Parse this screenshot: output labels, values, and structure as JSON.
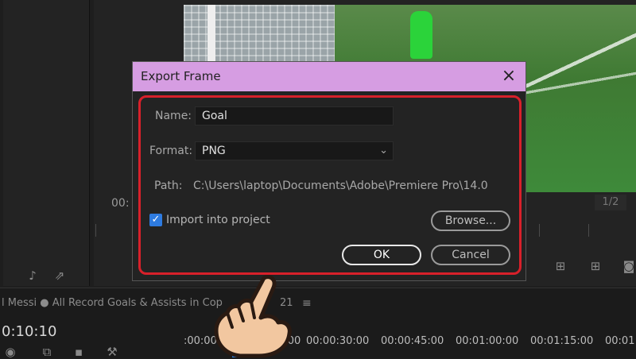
{
  "dialog": {
    "title": "Export Frame",
    "close_icon": "×",
    "name_label": "Name:",
    "name_value": "Goal",
    "format_label": "Format:",
    "format_value": "PNG",
    "format_chevron": "⌄",
    "path_label": "Path:",
    "path_value": "C:\\Users\\laptop\\Documents\\Adobe\\Premiere Pro\\14.0",
    "import_checkbox_mark": "✓",
    "import_label": "Import into project",
    "browse_label": "Browse...",
    "ok_label": "OK",
    "cancel_label": "Cancel",
    "highlight_color": "#d8202a",
    "titlebar_color": "#d69de2"
  },
  "monitor": {
    "partial_timecode": "00:",
    "page_indicator": "1/2"
  },
  "timeline": {
    "sequence_tab": "l Messi ● All Record Goals & Assists in Cop",
    "sequence_tab_tail": "21",
    "menu_icon": "≡",
    "timecode": "0:10:10",
    "ruler_labels": [
      ":00:00",
      "00:00:15:00",
      "00:00:30:00",
      "00:00:45:00",
      "00:01:00:00",
      "00:01:15:00",
      "00:01"
    ]
  },
  "icons": {
    "music_icon": "♪",
    "export_icon": "⇗"
  },
  "colors": {
    "accent_blue": "#2e7be0",
    "panel_bg": "#232323"
  }
}
